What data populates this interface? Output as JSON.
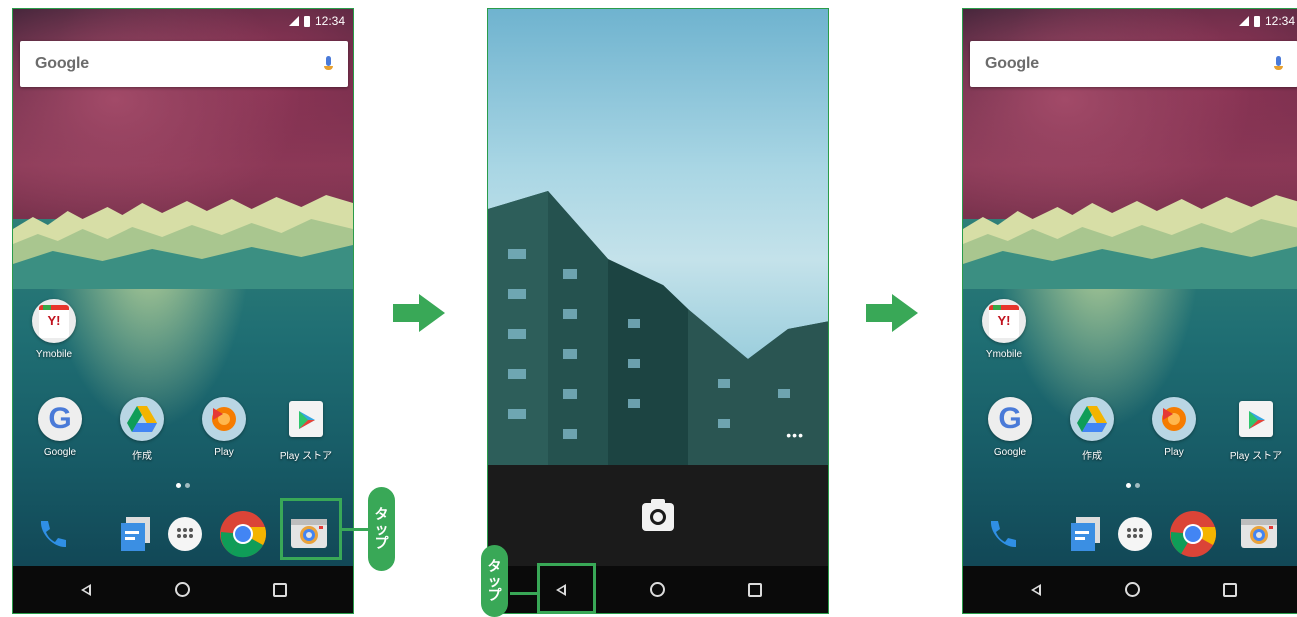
{
  "screens": [
    {
      "id": "home-before",
      "status_time": "12:34",
      "search_logo": "Google",
      "apps": [
        {
          "label": "Ymobile",
          "icon": "ymobile-icon"
        },
        {
          "label": "Google",
          "icon": "google-folder-icon"
        },
        {
          "label": "作成",
          "icon": "drive-folder-icon"
        },
        {
          "label": "Play",
          "icon": "play-folder-icon"
        },
        {
          "label": "Play ストア",
          "icon": "play-store-icon"
        }
      ],
      "dock": [
        "phone-icon",
        "messages-icon",
        "app-drawer-icon",
        "chrome-icon",
        "camera-icon"
      ],
      "nav": [
        "back-icon",
        "home-icon",
        "recents-icon"
      ]
    },
    {
      "id": "camera-app",
      "shutter_icon": "camera-shutter-icon",
      "more_label": "•••",
      "nav": [
        "back-icon",
        "home-icon",
        "recents-icon"
      ]
    },
    {
      "id": "home-after",
      "status_time": "12:34",
      "search_logo": "Google",
      "apps": [
        {
          "label": "Ymobile",
          "icon": "ymobile-icon"
        },
        {
          "label": "Google",
          "icon": "google-folder-icon"
        },
        {
          "label": "作成",
          "icon": "drive-folder-icon"
        },
        {
          "label": "Play",
          "icon": "play-folder-icon"
        },
        {
          "label": "Play ストア",
          "icon": "play-store-icon"
        }
      ],
      "dock": [
        "phone-icon",
        "messages-icon",
        "app-drawer-icon",
        "chrome-icon",
        "camera-icon"
      ],
      "nav": [
        "back-icon",
        "home-icon",
        "recents-icon"
      ]
    }
  ],
  "callouts": [
    {
      "target": "camera-icon",
      "text": [
        "タ",
        "ッ",
        "プ"
      ]
    },
    {
      "target": "back-button",
      "text": [
        "タ",
        "ッ",
        "プ"
      ]
    }
  ],
  "colors": {
    "accent_green": "#39a857",
    "nav_bar": "#0a0a0a"
  }
}
